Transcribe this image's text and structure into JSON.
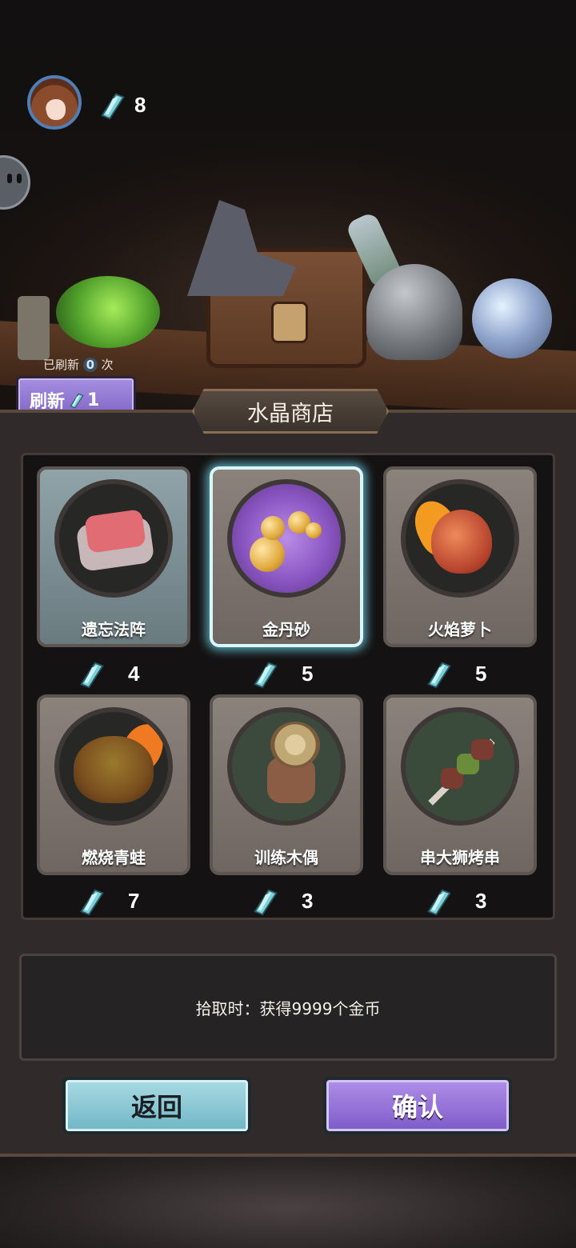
{
  "player": {
    "crystal_count": "8"
  },
  "refresh": {
    "info_prefix": "已刷新",
    "count": "0",
    "info_suffix": "次",
    "button_label": "刷新",
    "cost": "1"
  },
  "shop": {
    "title": "水晶商店",
    "items": [
      {
        "name": "遗忘法阵",
        "price": "4"
      },
      {
        "name": "金丹砂",
        "price": "5"
      },
      {
        "name": "火焰萝卜",
        "price": "5"
      },
      {
        "name": "燃烧青蛙",
        "price": "7"
      },
      {
        "name": "训练木偶",
        "price": "3"
      },
      {
        "name": "串大狮烤串",
        "price": "3"
      }
    ],
    "selected_index": 1
  },
  "description": {
    "text": "拾取时：获得9999个金币"
  },
  "buttons": {
    "back": "返回",
    "confirm": "确认"
  },
  "colors": {
    "crystal": "#7ad0d8",
    "back_button": "#8ccbd6",
    "confirm_button": "#9474db",
    "selected_glow": "#78e6ff"
  },
  "icons": {
    "currency": "crystal-icon"
  }
}
